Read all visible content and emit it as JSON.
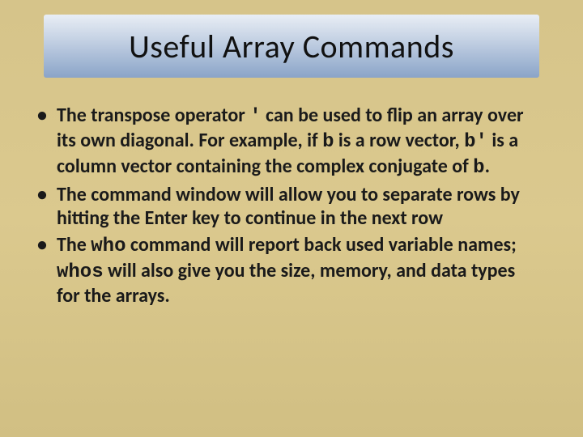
{
  "title": "Useful Array Commands",
  "bullets": [
    {
      "pre": "The transpose operator ",
      "code1": "'",
      "mid1": " can be used to flip an array over its own diagonal.  For example, if ",
      "code2": "b",
      "mid2": " is a row vector, ",
      "code3": "b'",
      "mid3": " is a column vector containing the complex conjugate of ",
      "code4": "b",
      "post": "."
    },
    {
      "pre": "The command window will allow you to separate rows by hitting the Enter key to continue in the next row",
      "code1": "",
      "mid1": "",
      "code2": "",
      "mid2": "",
      "code3": "",
      "mid3": "",
      "code4": "",
      "post": ""
    },
    {
      "pre": "The ",
      "code1": "who",
      "mid1": " command will report back used variable names; ",
      "code2": "whos",
      "mid2": " will also give you the size, memory, and data types for the arrays.",
      "code3": "",
      "mid3": "",
      "code4": "",
      "post": ""
    }
  ]
}
